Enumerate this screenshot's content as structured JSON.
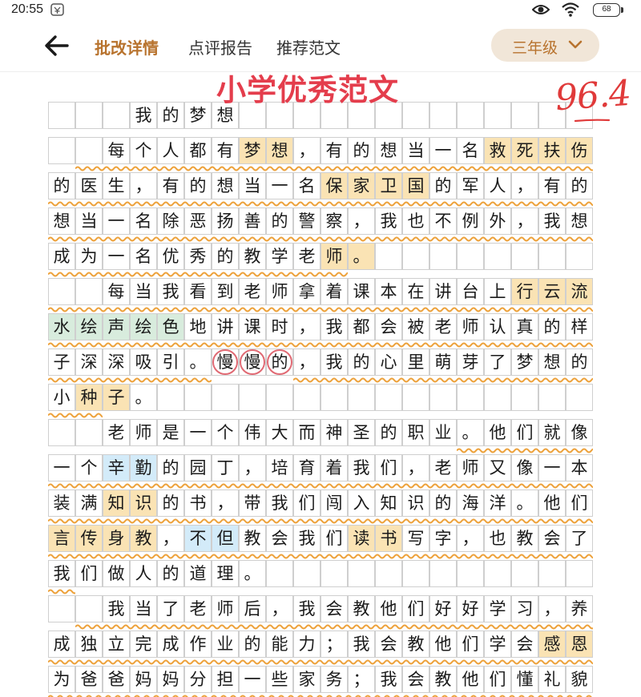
{
  "status_bar": {
    "time": "20:55",
    "battery": "68"
  },
  "nav": {
    "tabs": [
      "批改详情",
      "点评报告",
      "推荐范文"
    ],
    "active_tab_index": 0,
    "grade_select": "三年级"
  },
  "essay": {
    "headline": "小学优秀范文",
    "score": "96.4",
    "rows": [
      "   我的梦想",
      "  每个人都有梦想，有的想当一名救死扶伤",
      "的医生，有的想当一名保家卫国的军人，有的",
      "想当一名除恶扬善的警察，我也不例外，我想",
      "成为一名优秀的教学老师。",
      "  每当我看到老师拿着课本在讲台上行云流",
      "水绘声绘色地讲课时，我都会被老师认真的样",
      "子深深吸引。慢慢的，我的心里萌芽了梦想的",
      "小种子。",
      "  老师是一个伟大而神圣的职业。他们就像",
      "一个辛勤的园丁，培育着我们，老师又像一本",
      "装满知识的书，带我们闯入知识的海洋。他们",
      "言传身教，不但教会我们读书写字，也教会了",
      "我们做人的道理。",
      "  我当了老师后，我会教他们好好学习，养",
      "成独立完成作业的能力；我会教他们学会感恩",
      "为爸爸妈妈分担一些家务；我会教他们懂礼貌"
    ]
  },
  "colors": {
    "accent": "#b8732e",
    "highlight_yellow": "#fae3b4",
    "highlight_green": "#d8ecdd",
    "highlight_blue": "#d3ebf9",
    "wave": "#eda23c",
    "score_red": "#e03a3a"
  },
  "icons": [
    "app-notification-icon",
    "eye-icon",
    "wifi-icon",
    "battery-icon",
    "back-arrow-icon",
    "chevron-down-icon"
  ]
}
